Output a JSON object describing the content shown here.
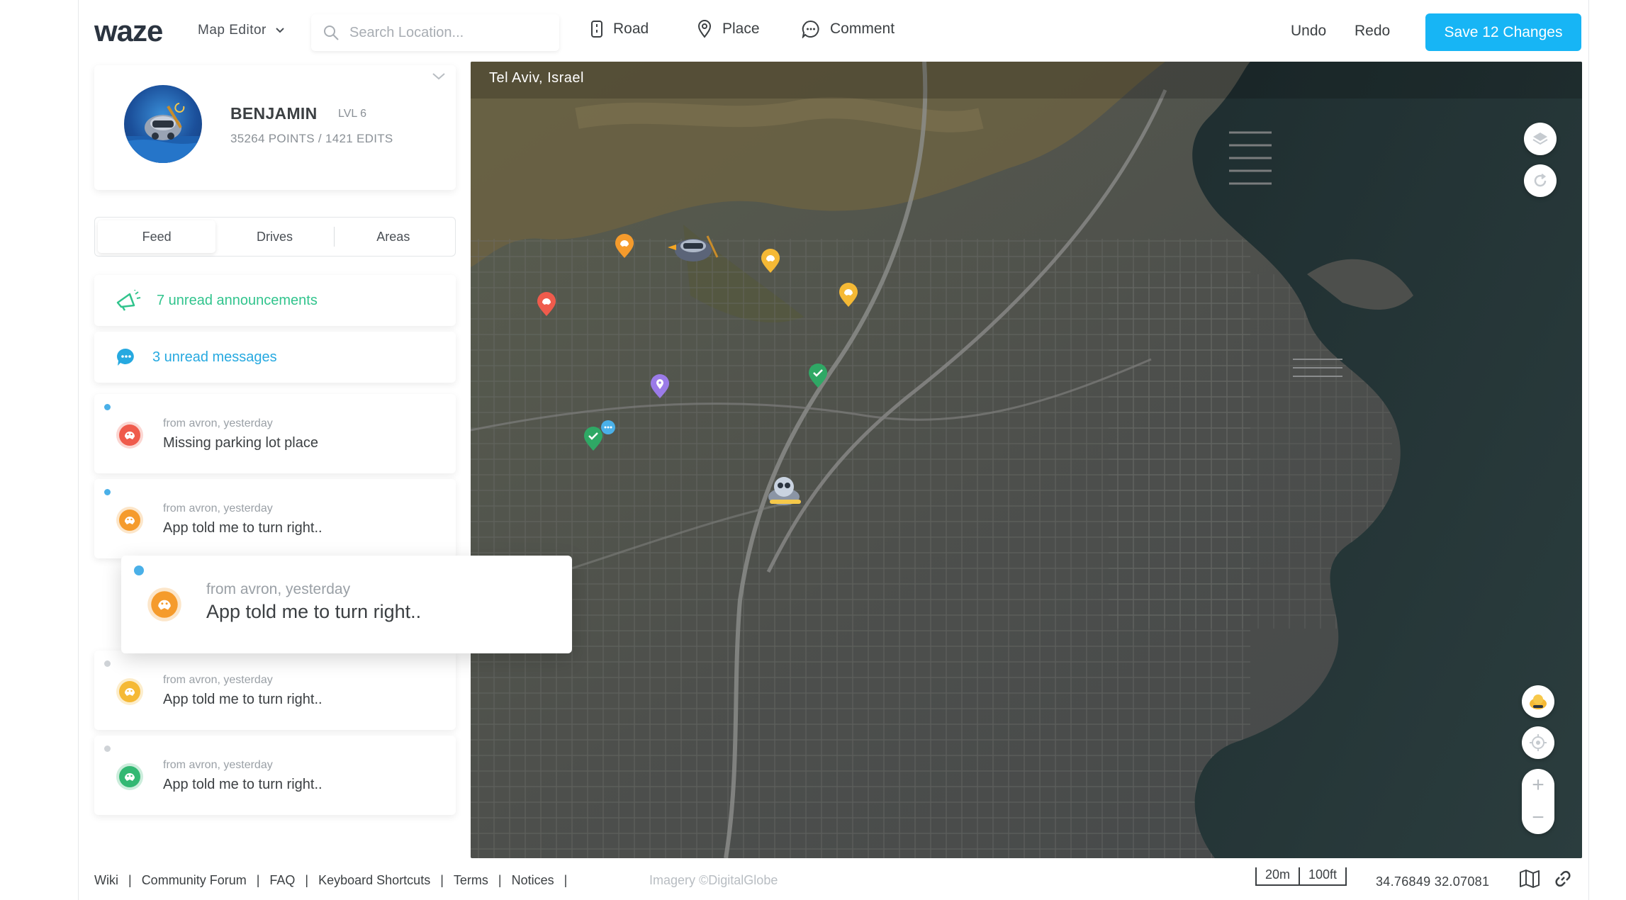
{
  "header": {
    "logo": "waze",
    "mode_label": "Map Editor",
    "search_placeholder": "Search Location...",
    "tools": {
      "road": "Road",
      "place": "Place",
      "comment": "Comment"
    },
    "undo": "Undo",
    "redo": "Redo",
    "save": "Save 12 Changes"
  },
  "profile": {
    "name": "BENJAMIN",
    "level": "LVL 6",
    "stats": "35264 POINTS  / 1421 EDITS"
  },
  "tabs": [
    "Feed",
    "Drives",
    "Areas"
  ],
  "feed": {
    "announcements": "7 unread announcements",
    "messages": "3 unread messages",
    "items": [
      {
        "meta": "from avron,  yesterday",
        "title": "Missing parking lot place",
        "color": "#ef5b4c"
      },
      {
        "meta": "from avron,  yesterday",
        "title": "App told me to turn right..",
        "color": "#f59b2c"
      },
      {
        "meta": "from avron,  yesterday",
        "title": "App told me to turn right..",
        "color": "#f5b935"
      },
      {
        "meta": "from avron,  yesterday",
        "title": "App told me to turn right..",
        "color": "#33b873"
      }
    ],
    "popup": {
      "meta": "from avron,  yesterday",
      "title": "App told me to turn right..",
      "color": "#f59b2c"
    }
  },
  "map": {
    "location": "Tel Aviv, Israel"
  },
  "footer": {
    "links": [
      "Wiki",
      "Community Forum",
      "FAQ",
      "Keyboard Shortcuts",
      "Terms",
      "Notices"
    ],
    "imagery": "Imagery ©DigitalGlobe",
    "scale_metric": "20m",
    "scale_imperial": "100ft",
    "coordinates": "34.76849  32.07081"
  },
  "colors": {
    "accent": "#17b5f5",
    "announcement": "#31c48d",
    "message": "#26a9e0"
  }
}
